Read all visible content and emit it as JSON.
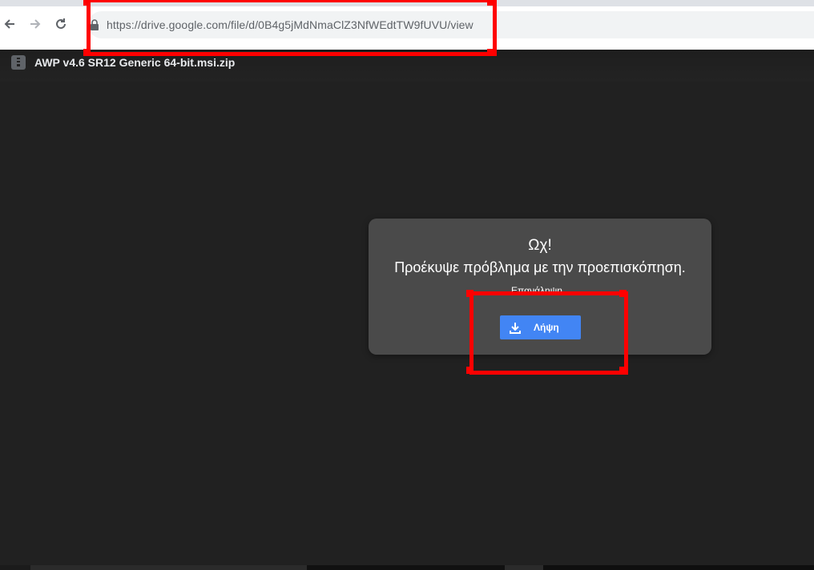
{
  "browser": {
    "url": "https://drive.google.com/file/d/0B4g5jMdNmaClZ3NfWEdtTW9fUVU/view",
    "icons": {
      "back": "arrow-left-icon",
      "forward": "arrow-right-icon",
      "reload": "reload-icon",
      "lock": "lock-icon"
    }
  },
  "viewer": {
    "file_name": "AWP v4.6 SR12 Generic 64-bit.msi.zip",
    "file_icon": "archive-file-icon"
  },
  "error": {
    "title": "Ωχ!",
    "message": "Προέκυψε πρόβλημα με την προεπισκόπηση.",
    "retry_label": "Επανάληψη",
    "download_label": "Λήψη",
    "download_icon": "download-icon"
  },
  "colors": {
    "background": "#212121",
    "card": "#4a4a4a",
    "download_button": "#4285f4",
    "annotation": "#ff0000"
  }
}
